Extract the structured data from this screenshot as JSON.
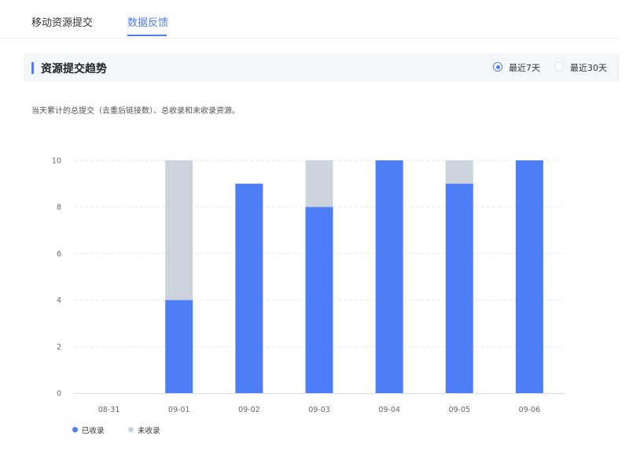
{
  "tabs": [
    {
      "label": "移动资源提交",
      "active": false
    },
    {
      "label": "数据反馈",
      "active": true
    }
  ],
  "section": {
    "title": "资源提交趋势",
    "range_options": [
      {
        "label": "最近7天",
        "selected": true
      },
      {
        "label": "最近30天",
        "selected": false
      }
    ]
  },
  "description": "当天累计的总提交（去重后链接数）、总收录和未收录资源。",
  "colors": {
    "accent": "#4d7ef7",
    "indexed": "#4d7ef7",
    "not_indexed": "#cdd3dc"
  },
  "chart_data": {
    "type": "bar",
    "stacked": true,
    "categories": [
      "08-31",
      "09-01",
      "09-02",
      "09-03",
      "09-04",
      "09-05",
      "09-06"
    ],
    "series": [
      {
        "name": "已收录",
        "color": "#4d7ef7",
        "values": [
          0,
          4,
          9,
          8,
          10,
          9,
          10
        ]
      },
      {
        "name": "未收录",
        "color": "#cdd3dc",
        "values": [
          0,
          6,
          0,
          2,
          0,
          1,
          0
        ]
      }
    ],
    "ylim": [
      0,
      10
    ],
    "yticks": [
      "0",
      "2",
      "4",
      "6",
      "8",
      "10"
    ],
    "grid": true,
    "legend": "bottom-left"
  }
}
